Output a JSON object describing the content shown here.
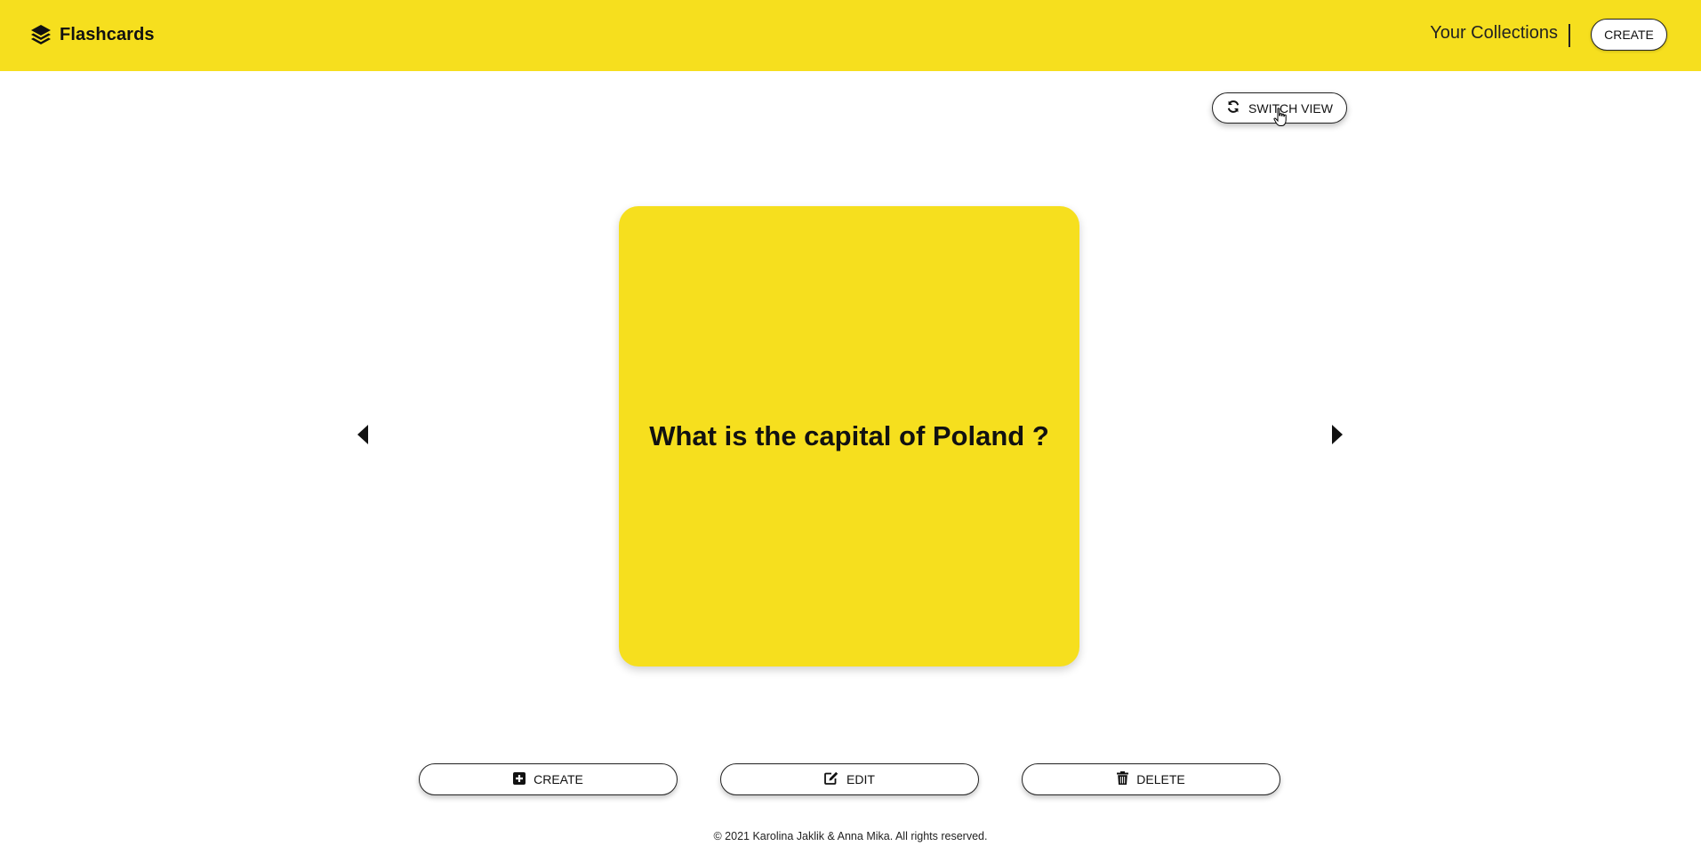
{
  "header": {
    "brand_name": "Flashcards",
    "brand_icon": "layers-icon",
    "nav_link": "Your Collections",
    "create_label": "CREATE"
  },
  "toolbar": {
    "switch_view_label": "SWITCH VIEW",
    "switch_view_icon": "refresh-icon"
  },
  "card": {
    "text": "What is the capital of Poland ?"
  },
  "navigation": {
    "prev_icon": "caret-left-icon",
    "next_icon": "caret-right-icon"
  },
  "actions": {
    "create_label": "CREATE",
    "create_icon": "plus-square-icon",
    "edit_label": "EDIT",
    "edit_icon": "edit-icon",
    "delete_label": "DELETE",
    "delete_icon": "trash-icon"
  },
  "footer": {
    "copyright": "© 2021 Karolina Jaklik & Anna Mika. All rights reserved."
  },
  "colors": {
    "accent": "#f6df1e",
    "text": "#111111",
    "background": "#ffffff"
  }
}
